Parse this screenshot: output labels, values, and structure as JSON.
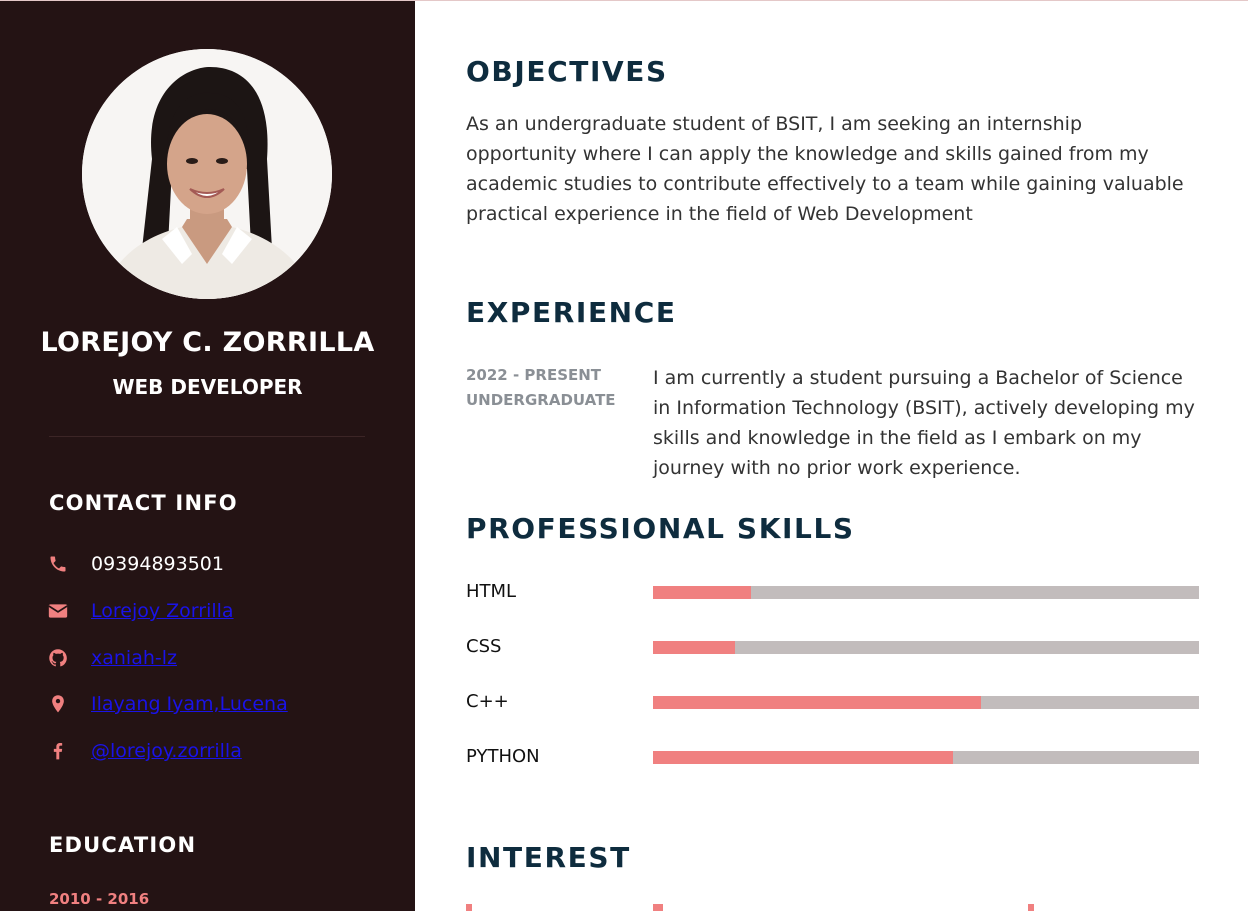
{
  "profile": {
    "name": "LOREJOY C. ZORRILLA",
    "title": "WEB DEVELOPER"
  },
  "contact": {
    "heading": "CONTACT INFO",
    "items": [
      {
        "icon": "phone-icon",
        "text": "09394893501",
        "is_link": false
      },
      {
        "icon": "envelope-icon",
        "text": "Lorejoy Zorrilla",
        "is_link": true
      },
      {
        "icon": "github-icon",
        "text": "xaniah-lz",
        "is_link": true
      },
      {
        "icon": "map-pin-icon",
        "text": "Ilayang Iyam,Lucena",
        "is_link": true
      },
      {
        "icon": "facebook-icon",
        "text": "@lorejoy.zorrilla",
        "is_link": true
      }
    ]
  },
  "education": {
    "heading": "EDUCATION",
    "first_year": "2010 - 2016"
  },
  "objectives": {
    "heading": "OBJECTIVES",
    "text": "As an undergraduate student of BSIT, I am seeking an internship opportunity where I can apply the knowledge and skills gained from my academic studies to contribute effectively to a team while gaining valuable practical experience in the field of Web Development"
  },
  "experience": {
    "heading": "EXPERIENCE",
    "period": "2022 - PRESENT",
    "role": "UNDERGRADUATE",
    "text": "I am currently a student pursuing a Bachelor of Science in Information Technology (BSIT), actively developing my skills and knowledge in the field as I embark on my journey with no prior work experience."
  },
  "skills": {
    "heading": "PROFESSIONAL SKILLS",
    "items": [
      {
        "name": "HTML",
        "level": 0.18
      },
      {
        "name": "CSS",
        "level": 0.15
      },
      {
        "name": "C++",
        "level": 0.6
      },
      {
        "name": "PYTHON",
        "level": 0.55
      }
    ]
  },
  "interest": {
    "heading": "INTEREST"
  },
  "colors": {
    "sidebar_bg": "#241314",
    "accent": "#f08080",
    "heading": "#0e2c3e",
    "bar_track": "#c2bcbc",
    "link": "#1a13e8"
  }
}
